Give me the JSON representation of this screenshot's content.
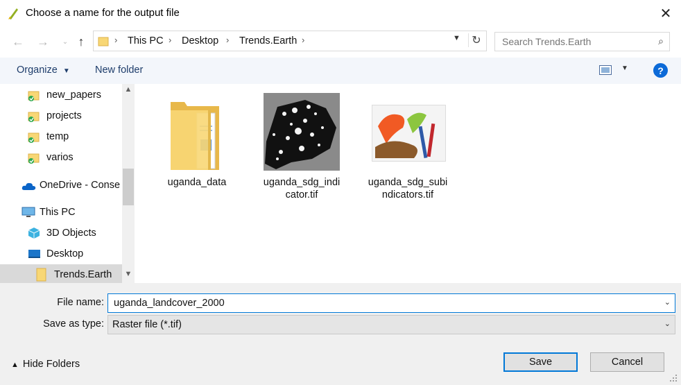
{
  "window": {
    "title": "Choose a name for the output file"
  },
  "nav": {
    "breadcrumbs": [
      "This PC",
      "Desktop",
      "Trends.Earth"
    ],
    "search_placeholder": "Search Trends.Earth"
  },
  "toolbar": {
    "organize_label": "Organize",
    "new_folder_label": "New folder",
    "help_label": "?"
  },
  "sidebar": {
    "items": [
      {
        "label": "new_papers",
        "icon": "folder-sync-icon"
      },
      {
        "label": "projects",
        "icon": "folder-sync-icon"
      },
      {
        "label": "temp",
        "icon": "folder-sync-icon"
      },
      {
        "label": "varios",
        "icon": "folder-sync-icon"
      },
      {
        "label": "OneDrive - Conse",
        "icon": "cloud-icon"
      },
      {
        "label": "This PC",
        "icon": "computer-icon"
      },
      {
        "label": "3D Objects",
        "icon": "cube-icon"
      },
      {
        "label": "Desktop",
        "icon": "desktop-icon"
      },
      {
        "label": "Trends.Earth",
        "icon": "folder-icon",
        "selected": true
      }
    ]
  },
  "files": [
    {
      "name_line1": "uganda_data",
      "name_line2": "",
      "type": "folder"
    },
    {
      "name_line1": "uganda_sdg_indi",
      "name_line2": "cator.tif",
      "type": "raster-thumbnail"
    },
    {
      "name_line1": "uganda_sdg_subi",
      "name_line2": "ndicators.tif",
      "type": "paint-app-icon"
    }
  ],
  "form": {
    "file_name_label": "File name:",
    "file_name_value": "uganda_landcover_2000",
    "save_type_label": "Save as type:",
    "save_type_value": "Raster file (*.tif)",
    "hide_folders_label": "Hide Folders",
    "save_label": "Save",
    "cancel_label": "Cancel"
  },
  "colors": {
    "accent": "#0078d7",
    "link": "#1e3d6b",
    "folder": "#f8d775"
  }
}
